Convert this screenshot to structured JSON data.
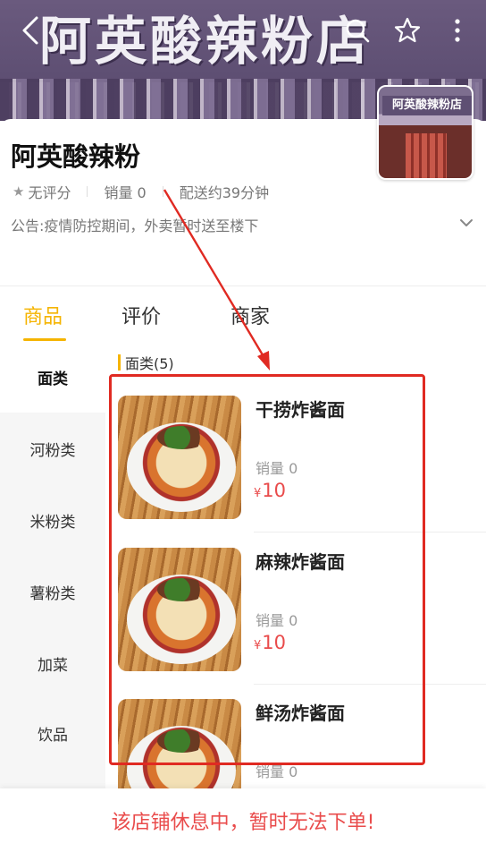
{
  "header": {
    "banner_sign_text": "阿英酸辣粉店",
    "back_icon": "chevron-left-icon",
    "search_icon": "search-icon",
    "favorite_icon": "star-outline-icon",
    "more_icon": "more-vertical-icon"
  },
  "store": {
    "thumb_sign_text": "阿英酸辣粉店",
    "name": "阿英酸辣粉",
    "rating": "无评分",
    "sales": "销量 0",
    "delivery": "配送约39分钟",
    "notice": "公告:疫情防控期间，外卖暂时送至楼下",
    "notice_toggle_icon": "chevron-down-icon"
  },
  "tabs": [
    {
      "label": "商品",
      "active": true
    },
    {
      "label": "评价",
      "active": false
    },
    {
      "label": "商家",
      "active": false
    }
  ],
  "categories": [
    {
      "label": "面类",
      "active": true
    },
    {
      "label": "河粉类",
      "active": false
    },
    {
      "label": "米粉类",
      "active": false
    },
    {
      "label": "薯粉类",
      "active": false
    },
    {
      "label": "加菜",
      "active": false
    },
    {
      "label": "饮品",
      "active": false
    }
  ],
  "section": {
    "title": "面类(5)"
  },
  "products": [
    {
      "name": "干捞炸酱面",
      "sales": "销量 0",
      "currency": "¥",
      "price": "10"
    },
    {
      "name": "麻辣炸酱面",
      "sales": "销量 0",
      "currency": "¥",
      "price": "10"
    },
    {
      "name": "鲜汤炸酱面",
      "sales": "销量 0",
      "currency": "",
      "price": ""
    }
  ],
  "footer": {
    "closed_message": "该店铺休息中，暂时无法下单!"
  },
  "colors": {
    "accent": "#f5b400",
    "price": "#e94b4b",
    "annotation": "#e02a22"
  }
}
